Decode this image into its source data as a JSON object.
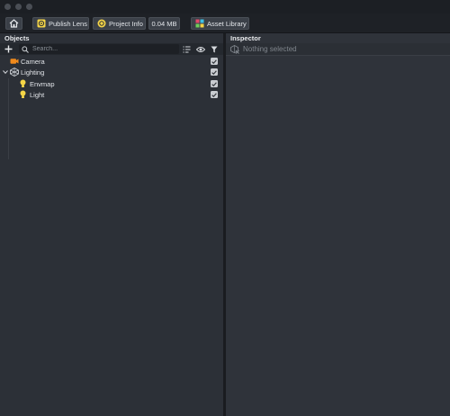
{
  "toolbar": {
    "publish_label": "Publish Lens",
    "project_info_label": "Project Info",
    "size_label": "0.04 MB",
    "asset_library_label": "Asset Library"
  },
  "objects_panel": {
    "title": "Objects",
    "search_placeholder": "Search...",
    "items": [
      {
        "label": "Camera",
        "icon": "camera-icon",
        "checked": true
      },
      {
        "label": "Lighting",
        "icon": "lighting-icon",
        "checked": true,
        "expanded": true
      },
      {
        "label": "Envmap",
        "icon": "lightbulb-icon",
        "checked": true
      },
      {
        "label": "Light",
        "icon": "lightbulb-icon",
        "checked": true
      }
    ]
  },
  "inspector": {
    "title": "Inspector",
    "status": "Nothing selected"
  },
  "colors": {
    "accent_yellow": "#f5d547",
    "camera_orange": "#f08a1c",
    "panel_bg": "#2c3037"
  }
}
